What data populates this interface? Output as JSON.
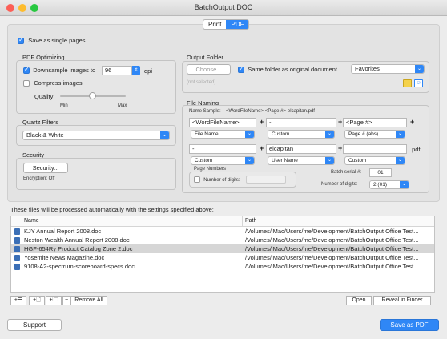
{
  "window": {
    "title": "BatchOutput DOC"
  },
  "tabs": [
    {
      "label": "Print",
      "active": false
    },
    {
      "label": "PDF",
      "active": true
    }
  ],
  "save_single_pages": {
    "label": "Save as single pages",
    "checked": true
  },
  "pdf_optimizing": {
    "title": "PDF Optimizing",
    "downsample": {
      "label": "Downsample images to",
      "checked": true,
      "value": "96",
      "unit": "dpi"
    },
    "compress": {
      "label": "Compress images",
      "checked": false
    },
    "quality": {
      "label": "Quality:",
      "min": "Min",
      "max": "Max"
    }
  },
  "quartz_filters": {
    "title": "Quartz Filters",
    "selected": "Black & White"
  },
  "security": {
    "title": "Security",
    "button": "Security...",
    "encryption": "Encryption: Off"
  },
  "output_folder": {
    "title": "Output Folder",
    "choose_button": "Choose...",
    "same_folder": {
      "label": "Same folder as original document",
      "checked": true
    },
    "location": "Favorites",
    "not_selected": "(not selected)"
  },
  "file_naming": {
    "title": "File Naming",
    "sample_label": "Name Sample:",
    "sample_value": "<WordFileName>-<Page #>-elcapitan.pdf",
    "row1_fields": [
      "<WordFileName>",
      "-",
      "<Page #>"
    ],
    "row1_popups": [
      "File Name",
      "Custom",
      "Page # (abs)"
    ],
    "row2_fields": [
      "-",
      "elcapitan",
      ""
    ],
    "row2_popups": [
      "Custom",
      "User Name",
      "Custom"
    ],
    "extension": ".pdf",
    "page_numbers": {
      "title": "Page Numbers",
      "label": "Number of digits:",
      "checked": false
    },
    "batch_serial": {
      "label": "Batch serial #:",
      "value": "01"
    },
    "digits": {
      "label": "Number of digits:",
      "value": "2 (01)"
    }
  },
  "files": {
    "caption": "These files will be processed automatically with the settings specified above:",
    "columns": [
      "Name",
      "Path"
    ],
    "rows": [
      {
        "name": "KJY Annual Report 2008.doc",
        "path": "/Volumes/iMac/Users/me/Development/BatchOutput Office Test..."
      },
      {
        "name": "Neston Wealth Annual Report 2008.doc",
        "path": "/Volumes/iMac/Users/me/Development/BatchOutput Office Test..."
      },
      {
        "name": "HGF-654Ry Product Catalog Zone 2.doc",
        "path": "/Volumes/iMac/Users/me/Development/BatchOutput Office Test..."
      },
      {
        "name": "Yosemite News Magazine.doc",
        "path": "/Volumes/iMac/Users/me/Development/BatchOutput Office Test..."
      },
      {
        "name": "9108-A2-spectrum-scoreboard-specs.doc",
        "path": "/Volumes/iMac/Users/me/Development/BatchOutput Office Test..."
      }
    ]
  },
  "list_toolbar": {
    "remove_all": "Remove All",
    "open": "Open",
    "reveal": "Reveal in Finder"
  },
  "footer": {
    "support": "Support",
    "save": "Save as PDF"
  },
  "colors": {
    "accent": "#2f87f6",
    "close": "#fc5f57",
    "minimize": "#fdbc2e",
    "zoom": "#28c840"
  }
}
